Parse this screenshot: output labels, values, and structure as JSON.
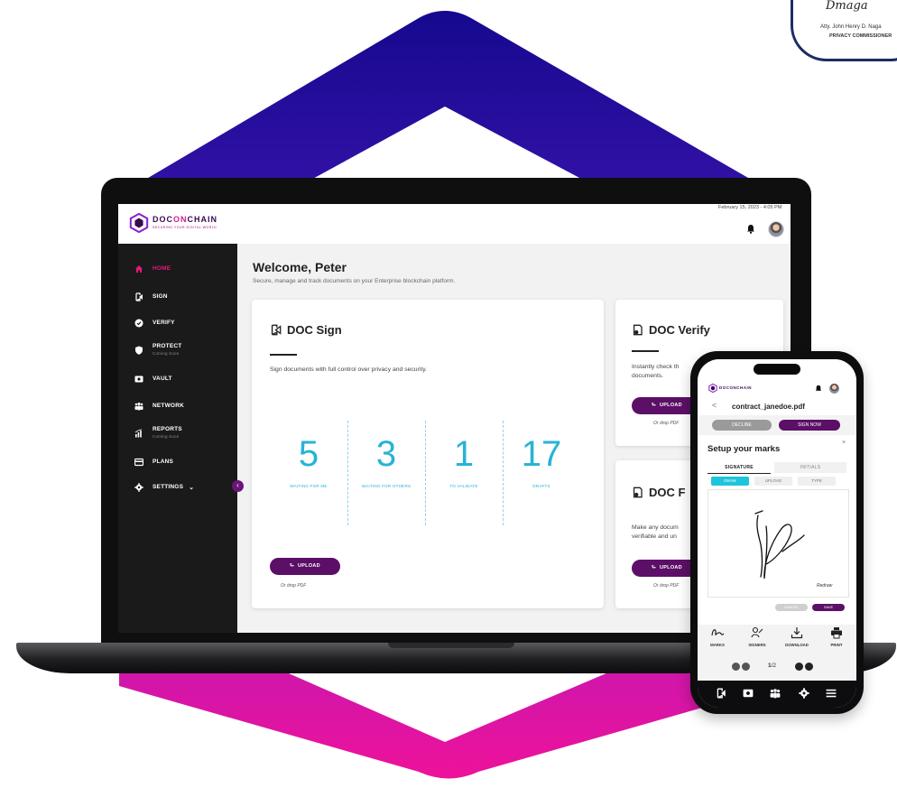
{
  "colors": {
    "brand_purple": "#5c0f67",
    "accent_pink": "#e5197a",
    "stat_cyan": "#27b3d6",
    "cyan_tab": "#1ec4dc",
    "hex_blue": "#1a0fa0",
    "hex_magenta": "#e0148c"
  },
  "seal": {
    "line1": "Atty. John Henry D. Naga",
    "line2": "PRIVACY COMMISSIONER"
  },
  "app": {
    "logo_doc": "DOC",
    "logo_on": "ON",
    "logo_chain": "CHAIN",
    "logo_tagline": "SECURING YOUR DIGITAL WORLD",
    "datetime": "February 15, 2023 - 4:05 PM"
  },
  "sidebar": {
    "items": [
      {
        "label": "HOME",
        "icon": "home-icon",
        "active": true
      },
      {
        "label": "SIGN",
        "icon": "sign-icon"
      },
      {
        "label": "VERIFY",
        "icon": "check-circle-icon"
      },
      {
        "label": "PROTECT",
        "sub": "Coming Soon",
        "icon": "shield-icon"
      },
      {
        "label": "VAULT",
        "icon": "vault-icon"
      },
      {
        "label": "NETWORK",
        "icon": "network-icon"
      },
      {
        "label": "REPORTS",
        "sub": "Coming Soon",
        "icon": "reports-icon"
      },
      {
        "label": "PLANS",
        "icon": "plans-icon"
      },
      {
        "label": "SETTINGS",
        "icon": "gear-icon"
      }
    ]
  },
  "main": {
    "welcome": "Welcome, Peter",
    "subtitle": "Secure, manage and track documents on your Enterprise blockchain platform.",
    "sign_card": {
      "title": "DOC Sign",
      "description": "Sign documents with full control over privacy and security.",
      "stats": [
        {
          "value": "5",
          "label": "WAITING FOR ME"
        },
        {
          "value": "3",
          "label": "WAITING FOR OTHERS"
        },
        {
          "value": "1",
          "label": "TO VALIDATE"
        },
        {
          "value": "17",
          "label": "DRAFTS"
        }
      ],
      "upload": "UPLOAD",
      "drop": "Or drop PDF"
    },
    "verify_card": {
      "title": "DOC Verify",
      "description_l1": "Instantly check th",
      "description_l2": "documents.",
      "upload": "UPLOAD",
      "drop": "Or drop PDF"
    },
    "protect_card": {
      "title": "DOC F",
      "description_l1": "Make any docum",
      "description_l2": "verifiable and un",
      "upload": "UPLOAD",
      "drop": "Or drop PDF"
    }
  },
  "phone": {
    "logo": "DOCONCHAIN",
    "back": "<",
    "filename": "contract_janedoe.pdf",
    "decline": "DECLINE",
    "sign_now": "SIGN NOW",
    "modal_title": "Setup your marks",
    "close": "×",
    "tab_signature": "SIGNATURE",
    "tab_initials": "INITIALS",
    "sub_draw": "DRAW",
    "sub_upload": "UPLOAD",
    "sub_type": "TYPE",
    "redraw": "Redraw",
    "cancel": "CANCEL",
    "save": "SAVE",
    "tools": [
      {
        "label": "MARKS",
        "icon": "marks-icon"
      },
      {
        "label": "SIGNERS",
        "icon": "signers-icon"
      },
      {
        "label": "DOWNLOAD",
        "icon": "download-icon"
      },
      {
        "label": "PRINT",
        "icon": "print-icon"
      }
    ],
    "page_current": "1",
    "page_total": "/2"
  }
}
